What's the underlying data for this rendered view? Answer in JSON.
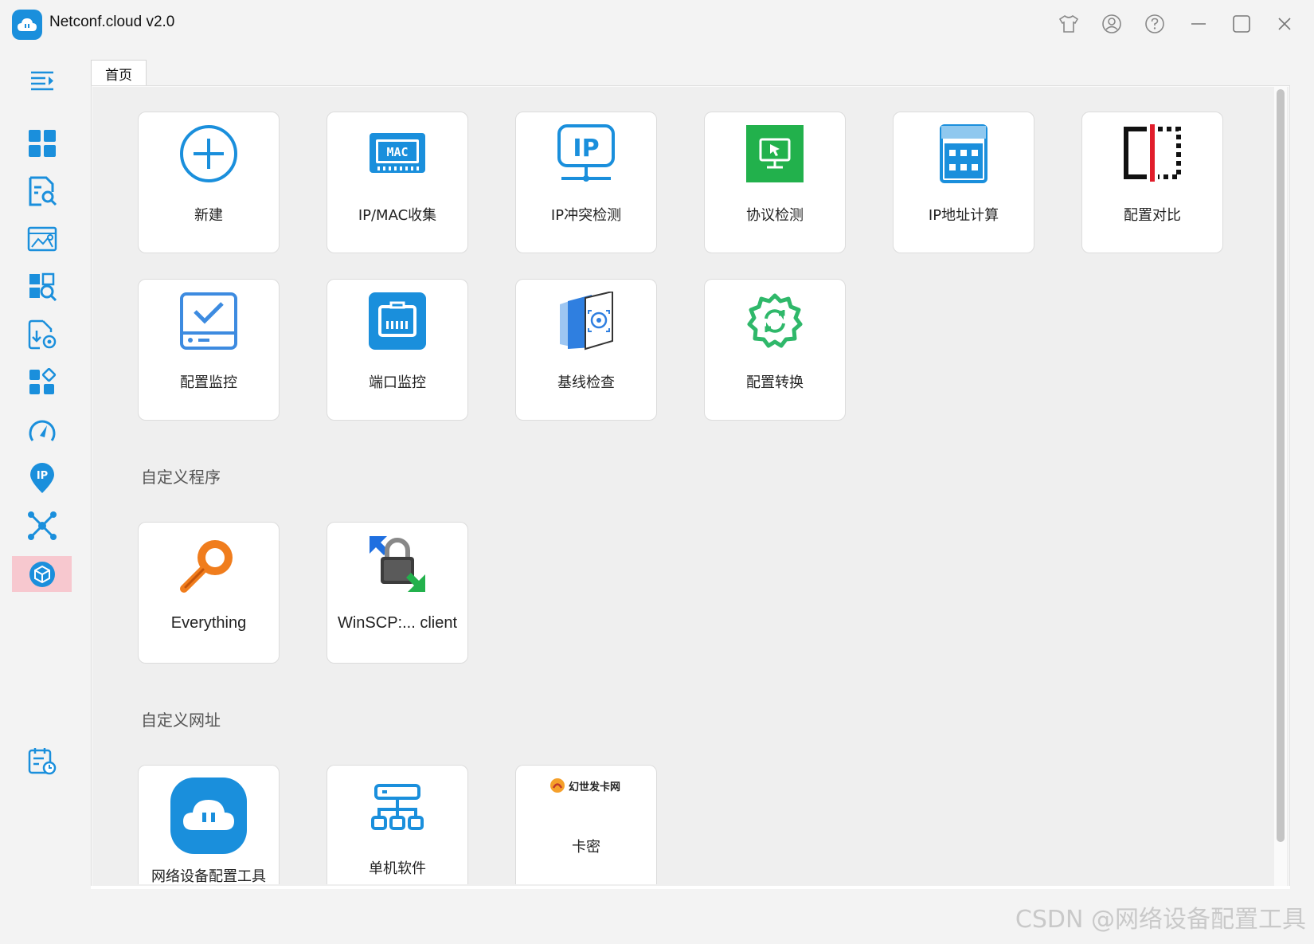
{
  "window": {
    "title": "Netconf.cloud v2.0"
  },
  "tabs": [
    {
      "label": "首页"
    }
  ],
  "tools": [
    {
      "label": "新建",
      "icon": "plus-circle-icon"
    },
    {
      "label": "IP/MAC收集",
      "icon": "mac-chip-icon"
    },
    {
      "label": "IP冲突检测",
      "icon": "ip-monitor-icon"
    },
    {
      "label": "协议检测",
      "icon": "protocol-monitor-icon"
    },
    {
      "label": "IP地址计算",
      "icon": "calculator-icon"
    },
    {
      "label": "配置对比",
      "icon": "compare-icon"
    },
    {
      "label": "配置监控",
      "icon": "config-monitor-icon"
    },
    {
      "label": "端口监控",
      "icon": "port-icon"
    },
    {
      "label": "基线检查",
      "icon": "baseline-check-icon"
    },
    {
      "label": "配置转换",
      "icon": "gear-convert-icon"
    }
  ],
  "sections": {
    "custom_programs": "自定义程序",
    "custom_urls": "自定义网址"
  },
  "programs": [
    {
      "label": "Everything",
      "icon": "magnifier-icon"
    },
    {
      "label": "WinSCP:... client",
      "icon": "winscp-lock-icon"
    }
  ],
  "urls": [
    {
      "label": "网络设备配置工具",
      "icon": "cloud-app-icon"
    },
    {
      "label": "单机软件",
      "icon": "network-tree-icon"
    },
    {
      "label": "卡密",
      "icon": "shop-logo-icon",
      "brand": "幻世发卡网"
    }
  ],
  "sidebar": {
    "items": [
      "menu-toggle-icon",
      "dashboard-icon",
      "document-search-icon",
      "image-gear-icon",
      "search-grid-icon",
      "download-gear-icon",
      "apps-icon",
      "speedometer-icon",
      "ip-pin-icon",
      "network-icon",
      "package-icon",
      "calendar-clock-icon"
    ]
  },
  "watermark": "CSDN @网络设备配置工具",
  "colors": {
    "accent": "#1a8fdc",
    "active_sidebar": "#f7c8cf",
    "green": "#22b14c",
    "orange": "#f07d1d"
  }
}
